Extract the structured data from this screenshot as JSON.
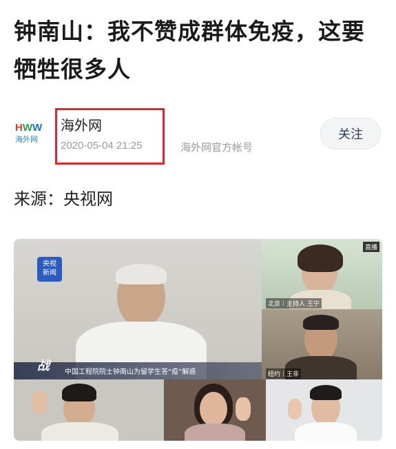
{
  "article": {
    "title": "钟南山：我不赞成群体免疫，这要牺牲很多人",
    "source": "来源：央视网"
  },
  "author": {
    "logo_letters": "HWW",
    "logo_text": "海外网",
    "name": "海外网",
    "time": "2020-05-04 21:25",
    "account": "海外网官方帐号",
    "follow_label": "关注",
    "highlight_color": "#e0262c"
  },
  "video": {
    "cctv_logo": "央视\n新闻",
    "caption": "中国工程院院士钟南山为留学生答“疫”解惑",
    "overlay_glyph": "战",
    "tag_r1": "北京｜主持人 王宁",
    "tag_r2": "纽约｜王非",
    "corner_tag": "直播"
  }
}
